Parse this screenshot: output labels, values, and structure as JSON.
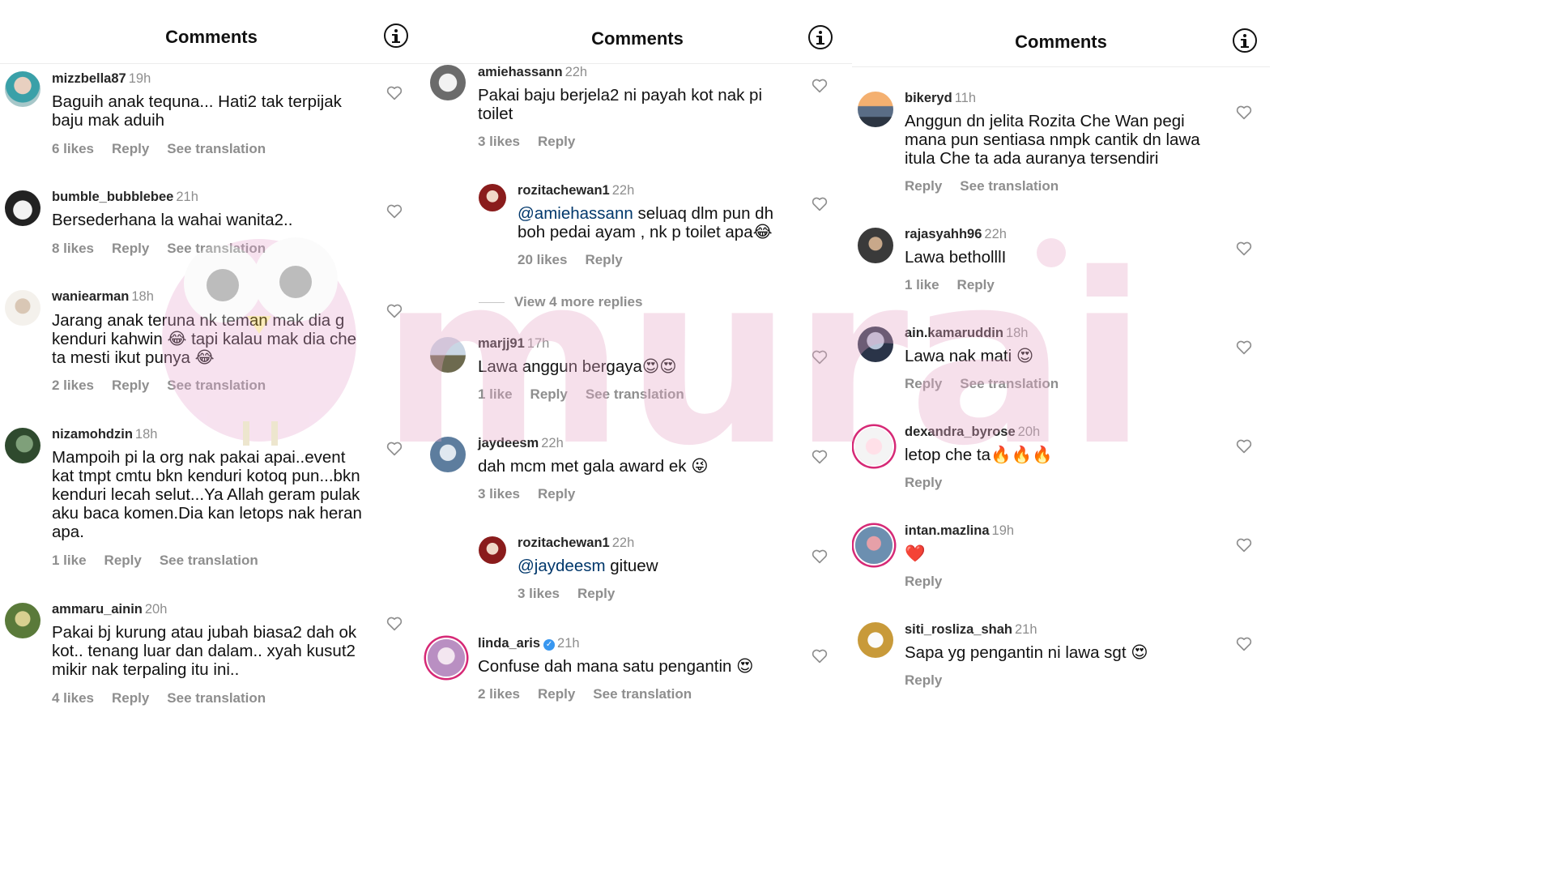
{
  "colors": {
    "accent_ring": "#d62976",
    "muted": "#8e8e8e",
    "mention": "#00376b",
    "verified": "#3897f0",
    "watermark": "#e8a8c8"
  },
  "watermark_text": "murai",
  "panels": [
    {
      "title": "Comments",
      "comments": [
        {
          "user": "mizzbella87",
          "time": "19h",
          "text": "Baguih anak tequna... Hati2 tak terpijak baju mak aduih",
          "likes": "6 likes",
          "reply": "Reply",
          "translate": "See translation"
        },
        {
          "user": "bumble_bubblebee",
          "time": "21h",
          "text": "Bersederhana la wahai wanita2..",
          "likes": "8 likes",
          "reply": "Reply",
          "translate": "See translation"
        },
        {
          "user": "waniearman",
          "time": "18h",
          "text": "Jarang anak teruna nk teman mak dia g kenduri kahwin 😂 tapi kalau mak dia che ta mesti ikut punya 😂",
          "likes": "2 likes",
          "reply": "Reply",
          "translate": "See translation"
        },
        {
          "user": "nizamohdzin",
          "time": "18h",
          "text": "Mampoih pi la org nak pakai apai..event kat tmpt cmtu bkn kenduri kotoq pun...bkn kenduri lecah selut...Ya Allah geram pulak aku baca komen.Dia kan letops nak heran apa.",
          "likes": "1 like",
          "reply": "Reply",
          "translate": "See translation"
        },
        {
          "user": "ammaru_ainin",
          "time": "20h",
          "text": "Pakai bj kurung atau jubah biasa2 dah ok kot.. tenang luar dan dalam.. xyah kusut2 mikir nak terpaling itu ini..",
          "likes": "4 likes",
          "reply": "Reply",
          "translate": "See translation"
        }
      ]
    },
    {
      "title": "Comments",
      "comments": [
        {
          "user": "amiehassann",
          "time": "22h",
          "text": "Pakai baju berjela2 ni payah kot nak pi toilet",
          "likes": "3 likes",
          "reply": "Reply"
        },
        {
          "user": "rozitachewan1",
          "time": "22h",
          "mention": "@amiehassann",
          "text": " seluaq dlm pun dh boh pedai ayam , nk p toilet apa😂",
          "likes": "20 likes",
          "reply": "Reply"
        },
        {
          "user": "marjj91",
          "time": "17h",
          "text": "Lawa anggun bergaya😍😍",
          "likes": "1 like",
          "reply": "Reply",
          "translate": "See translation"
        },
        {
          "user": "jaydeesm",
          "time": "22h",
          "text": "dah mcm met gala award ek 😜",
          "likes": "3 likes",
          "reply": "Reply"
        },
        {
          "user": "rozitachewan1",
          "time": "22h",
          "mention": "@jaydeesm",
          "text": " gituew",
          "likes": "3 likes",
          "reply": "Reply"
        },
        {
          "user": "linda_aris",
          "time": "21h",
          "text": "Confuse dah mana satu pengantin 😍",
          "likes": "2 likes",
          "reply": "Reply",
          "translate": "See translation"
        }
      ],
      "view_more": "View 4 more replies"
    },
    {
      "title": "Comments",
      "comments": [
        {
          "user": "bikeryd",
          "time": "11h",
          "text": "Anggun dn jelita Rozita Che Wan pegi mana pun sentiasa nmpk cantik dn lawa itula Che ta ada auranya tersendiri",
          "reply": "Reply",
          "translate": "See translation"
        },
        {
          "user": "rajasyahh96",
          "time": "22h",
          "text": "Lawa betholllI",
          "likes": "1 like",
          "reply": "Reply"
        },
        {
          "user": "ain.kamaruddin",
          "time": "18h",
          "text": "Lawa nak mati 😍",
          "reply": "Reply",
          "translate": "See translation"
        },
        {
          "user": "dexandra_byrose",
          "time": "20h",
          "text": "letop che ta🔥🔥🔥",
          "reply": "Reply"
        },
        {
          "user": "intan.mazlina",
          "time": "19h",
          "text": "❤️",
          "reply": "Reply"
        },
        {
          "user": "siti_rosliza_shah",
          "time": "21h",
          "text": "Sapa yg pengantin ni lawa sgt 😍",
          "reply": "Reply"
        }
      ]
    }
  ]
}
